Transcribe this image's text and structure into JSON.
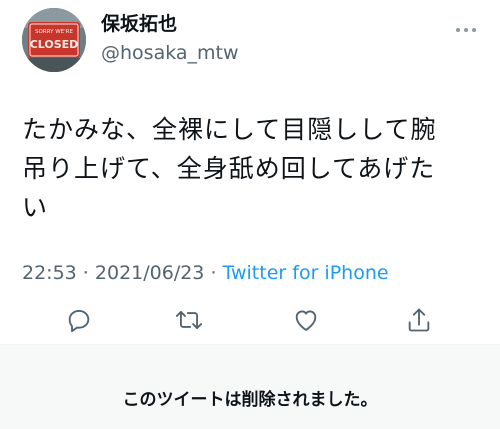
{
  "tweet": {
    "display_name": "保坂拓也",
    "handle": "@hosaka_mtw",
    "text_lines": [
      "たかみな、全裸にして目隠しして腕",
      "吊り上げて、全身舐め回してあげた",
      "い"
    ],
    "time": "22:53",
    "separator": " · ",
    "date": "2021/06/23",
    "source": "Twitter for iPhone",
    "avatar_sign": {
      "line1": "SORRY WE'RE",
      "line2": "CLOSED"
    }
  },
  "actions": {
    "reply": "reply-icon",
    "retweet": "retweet-icon",
    "like": "heart-icon",
    "share": "share-icon"
  },
  "deleted_notice": {
    "text": "このツイートは削除されました。"
  },
  "colors": {
    "primary_text": "#0f1419",
    "secondary_text": "#536471",
    "link": "#1d9bf0",
    "notice_bg": "#f7f9f9"
  }
}
